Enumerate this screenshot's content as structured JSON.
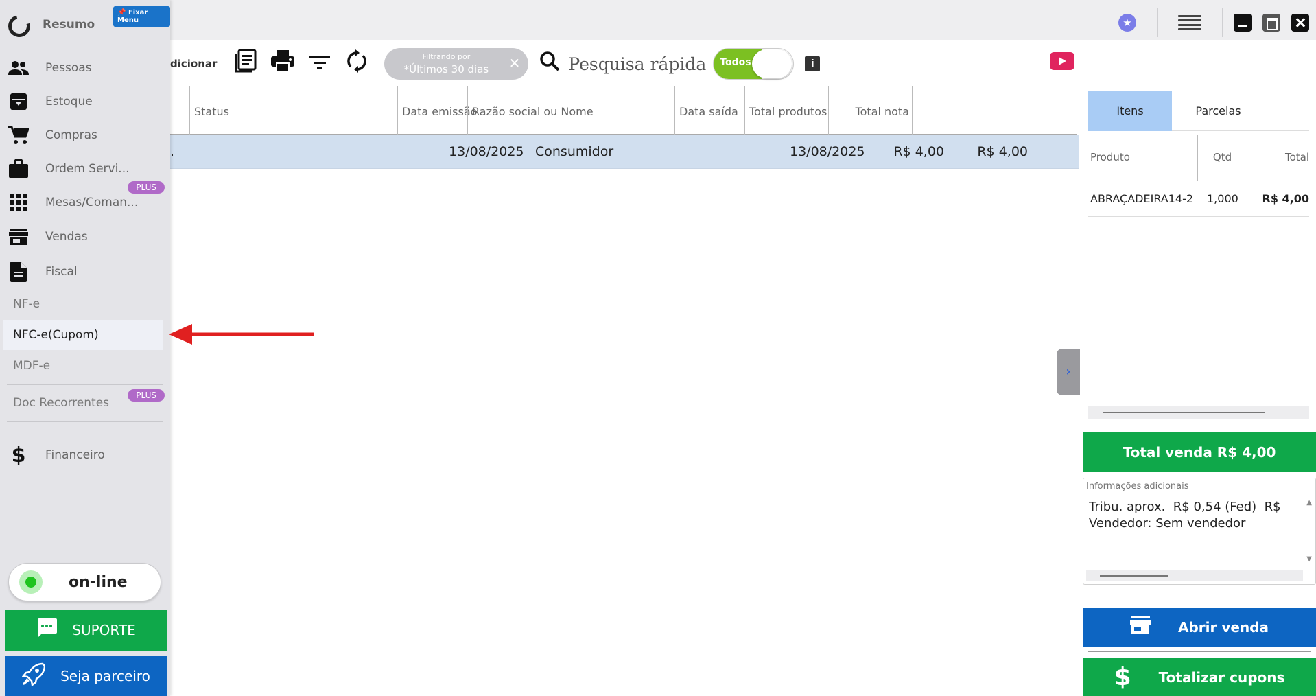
{
  "sidebar": {
    "title": "Resumo",
    "pin_label": "Fixar Menu",
    "items": [
      {
        "label": "Pessoas",
        "icon": "people-icon"
      },
      {
        "label": "Estoque",
        "icon": "inventory-icon"
      },
      {
        "label": "Compras",
        "icon": "cart-icon"
      },
      {
        "label": "Ordem Servi...",
        "icon": "briefcase-icon"
      },
      {
        "label": "Mesas/Coman...",
        "icon": "grid-icon",
        "badge": "PLUS"
      },
      {
        "label": "Vendas",
        "icon": "store-icon"
      },
      {
        "label": "Fiscal",
        "icon": "document-icon"
      }
    ],
    "fiscal_sub": [
      "NF-e",
      "NFC-e(Cupom)",
      "MDF-e"
    ],
    "doc_recorrentes": {
      "label": "Doc Recorrentes",
      "badge": "PLUS"
    },
    "financeiro": "Financeiro",
    "status": "on-line",
    "support_label": "SUPORTE",
    "partner_label": "Seja parceiro"
  },
  "toolbar": {
    "add_label": "dicionar",
    "filter_caption": "Filtrando por",
    "filter_value": "*Últimos 30 dias",
    "search_placeholder": "Pesquisa rápida",
    "toggle_label": "Todos"
  },
  "table": {
    "columns": [
      "Status",
      "Data emissão",
      "Razão social ou Nome",
      "Data saída",
      "Total produtos",
      "Total nota"
    ],
    "rows": [
      {
        "status": "",
        "data_emissao": "13/08/2025",
        "razao": "Consumidor",
        "data_saida": "13/08/2025",
        "total_produtos": "R$ 4,00",
        "total_nota": "R$ 4,00"
      }
    ]
  },
  "panel": {
    "tabs": [
      "Itens",
      "Parcelas"
    ],
    "item_columns": [
      "Produto",
      "Qtd",
      "Total"
    ],
    "items": [
      {
        "produto": "ABRAÇADEIRA14-2",
        "qtd": "1,000",
        "total": "R$ 4,00"
      }
    ],
    "total_venda": "Total venda R$ 4,00",
    "info_label": "Informações adicionais",
    "info_text": "Tribu. aprox.  R$ 0,54 (Fed)  R$\nVendedor: Sem vendedor",
    "abrir_venda": "Abrir venda",
    "totalizar": "Totalizar cupons"
  },
  "colors": {
    "accent_blue": "#0d65c2",
    "accent_green": "#0fa84a",
    "selected_row": "#d1dfef",
    "plus_badge": "#b06ac8",
    "annotation_arrow": "#e02020"
  }
}
